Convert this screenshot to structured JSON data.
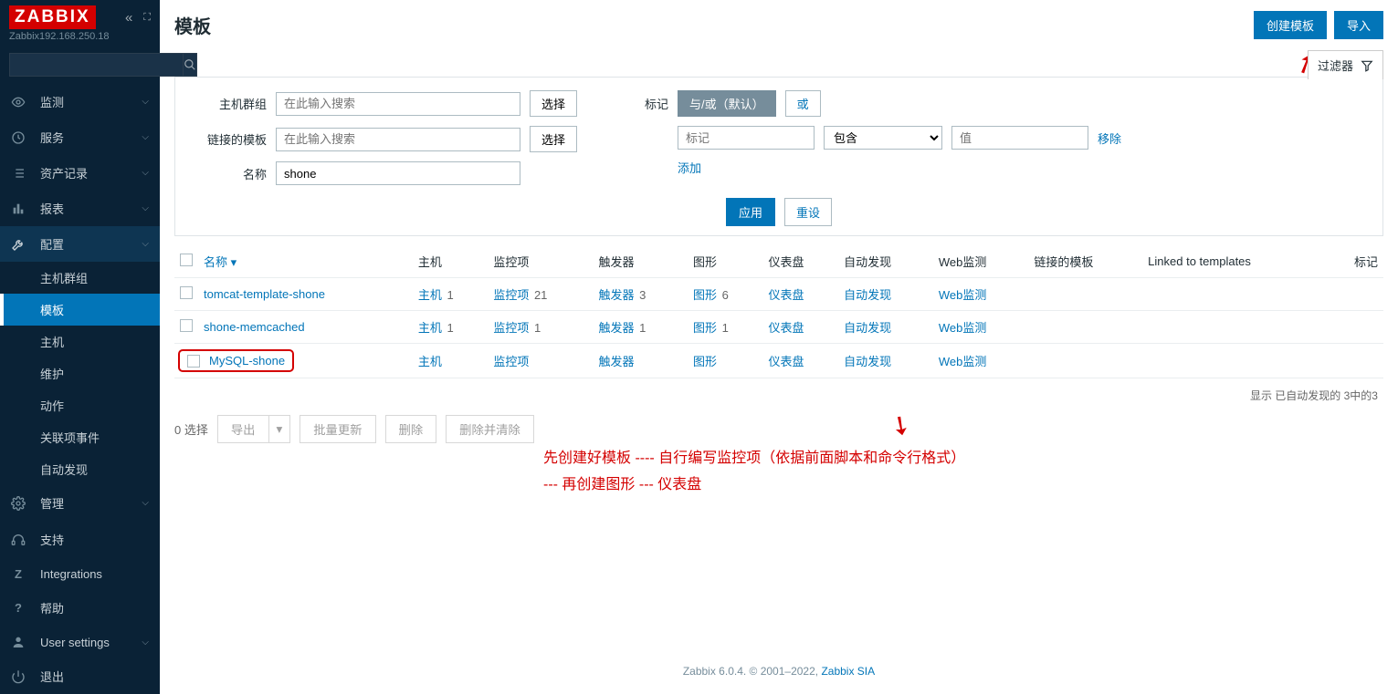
{
  "sidebar": {
    "logo": "ZABBIX",
    "server": "Zabbix192.168.250.18",
    "search_placeholder": "",
    "nav": [
      {
        "icon": "eye-icon",
        "label": "监测",
        "expandable": true
      },
      {
        "icon": "clock-icon",
        "label": "服务",
        "expandable": true
      },
      {
        "icon": "list-icon",
        "label": "资产记录",
        "expandable": true
      },
      {
        "icon": "bar-icon",
        "label": "报表",
        "expandable": true
      },
      {
        "icon": "wrench-icon",
        "label": "配置",
        "expandable": true,
        "active": true,
        "subs": [
          {
            "label": "主机群组"
          },
          {
            "label": "模板",
            "active": true
          },
          {
            "label": "主机"
          },
          {
            "label": "维护"
          },
          {
            "label": "动作"
          },
          {
            "label": "关联项事件"
          },
          {
            "label": "自动发现"
          }
        ]
      },
      {
        "icon": "gear-icon",
        "label": "管理",
        "expandable": true
      }
    ],
    "bottom": [
      {
        "icon": "headset-icon",
        "label": "支持"
      },
      {
        "icon": "z-icon",
        "label": "Integrations"
      },
      {
        "icon": "help-icon",
        "label": "帮助"
      },
      {
        "icon": "user-icon",
        "label": "User settings",
        "expandable": true
      },
      {
        "icon": "power-icon",
        "label": "退出"
      }
    ]
  },
  "header": {
    "title": "模板",
    "create_btn": "创建模板",
    "import_btn": "导入"
  },
  "filter": {
    "tab_label": "过滤器",
    "host_groups_label": "主机群组",
    "host_groups_placeholder": "在此输入搜索",
    "linked_templates_label": "链接的模板",
    "linked_templates_placeholder": "在此输入搜索",
    "name_label": "名称",
    "name_value": "shone",
    "select_btn": "选择",
    "tags_label": "标记",
    "seg_andor": "与/或（默认）",
    "seg_or": "或",
    "tag_placeholder": "标记",
    "operator": "包含",
    "value_placeholder": "值",
    "remove": "移除",
    "add": "添加",
    "apply": "应用",
    "reset": "重设"
  },
  "table": {
    "columns": {
      "name": "名称",
      "hosts": "主机",
      "items": "监控项",
      "triggers": "触发器",
      "graphs": "图形",
      "dashboards": "仪表盘",
      "discovery": "自动发现",
      "web": "Web监测",
      "linked_templates": "链接的模板",
      "linked_to": "Linked to templates",
      "tags": "标记"
    },
    "rows": [
      {
        "name": "tomcat-template-shone",
        "hosts": "主机",
        "hosts_n": "1",
        "items": "监控项",
        "items_n": "21",
        "triggers": "触发器",
        "triggers_n": "3",
        "graphs": "图形",
        "graphs_n": "6",
        "dashboards": "仪表盘",
        "discovery": "自动发现",
        "web": "Web监测"
      },
      {
        "name": "shone-memcached",
        "hosts": "主机",
        "hosts_n": "1",
        "items": "监控项",
        "items_n": "1",
        "triggers": "触发器",
        "triggers_n": "1",
        "graphs": "图形",
        "graphs_n": "1",
        "dashboards": "仪表盘",
        "discovery": "自动发现",
        "web": "Web监测"
      },
      {
        "name": "MySQL-shone",
        "hosts": "主机",
        "hosts_n": "",
        "items": "监控项",
        "items_n": "",
        "triggers": "触发器",
        "triggers_n": "",
        "graphs": "图形",
        "graphs_n": "",
        "dashboards": "仪表盘",
        "discovery": "自动发现",
        "web": "Web监测",
        "highlight": true
      }
    ],
    "footer": "显示 已自动发现的 3中的3"
  },
  "actions": {
    "selected": "0 选择",
    "export": "导出",
    "mass_update": "批量更新",
    "delete": "删除",
    "delete_clear": "删除并清除"
  },
  "annotation": {
    "line1": "先创建好模板 ----  自行编写监控项（依据前面脚本和命令行格式）",
    "line2": "--- 再创建图形  --- 仪表盘"
  },
  "footer": {
    "text": "Zabbix 6.0.4. © 2001–2022, ",
    "link": "Zabbix SIA"
  }
}
